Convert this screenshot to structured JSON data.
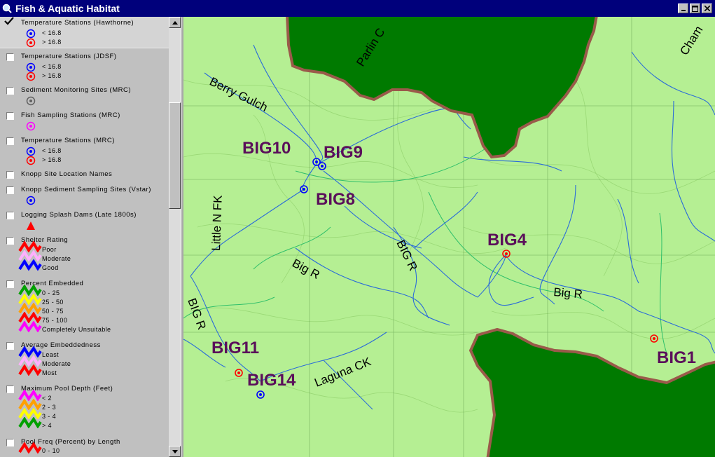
{
  "window": {
    "title": "Fish & Aquatic Habitat"
  },
  "toc": {
    "layers": [
      {
        "name": "Temperature Stations (Hawthorne)",
        "checked": true,
        "legend": [
          {
            "label": "< 16.8",
            "symbol": "blue-station-icon"
          },
          {
            "label": "> 16.8",
            "symbol": "red-station-icon"
          }
        ]
      },
      {
        "name": "Temperature Stations (JDSF)",
        "checked": false,
        "legend": [
          {
            "label": "< 16.8",
            "symbol": "blue-station-icon"
          },
          {
            "label": "> 16.8",
            "symbol": "red-station-icon"
          }
        ]
      },
      {
        "name": "Sediment Monitoring Sites (MRC)",
        "checked": false,
        "legend": [
          {
            "label": "",
            "symbol": "gray-station-icon"
          }
        ]
      },
      {
        "name": "Fish Sampling Stations (MRC)",
        "checked": false,
        "legend": [
          {
            "label": "",
            "symbol": "magenta-station-icon"
          }
        ]
      },
      {
        "name": "Temperature Stations (MRC)",
        "checked": false,
        "legend": [
          {
            "label": "< 16.8",
            "symbol": "blue-station-icon"
          },
          {
            "label": "> 16.8",
            "symbol": "red-station-icon"
          }
        ]
      },
      {
        "name": "Knopp Site Location Names",
        "checked": false,
        "legend": []
      },
      {
        "name": "Knopp Sediment Sampling Sites (Vstar)",
        "checked": false,
        "legend": [
          {
            "label": "",
            "symbol": "blue-station-icon"
          }
        ]
      },
      {
        "name": "Logging Splash Dams (Late 1800s)",
        "checked": false,
        "legend": [
          {
            "label": "",
            "symbol": "red-triangle-icon"
          }
        ]
      },
      {
        "name": "Shelter Rating",
        "checked": false,
        "legend": [
          {
            "label": "Poor",
            "color": "#ff0000"
          },
          {
            "label": "Moderate",
            "color": "#ffb0ff"
          },
          {
            "label": "Good",
            "color": "#0000ff"
          }
        ]
      },
      {
        "name": "Percent Embedded",
        "checked": false,
        "legend": [
          {
            "label": "0 - 25",
            "color": "#00a000"
          },
          {
            "label": "25 - 50",
            "color": "#ffff00"
          },
          {
            "label": "50 - 75",
            "color": "#ffa000"
          },
          {
            "label": "75 - 100",
            "color": "#ff0000"
          },
          {
            "label": "Completely Unsuitable",
            "color": "#ff00ff"
          }
        ]
      },
      {
        "name": "Average Embeddedness",
        "checked": false,
        "legend": [
          {
            "label": "Least",
            "color": "#0000ff"
          },
          {
            "label": "Moderate",
            "color": "#ffb0ff"
          },
          {
            "label": "Most",
            "color": "#ff0000"
          }
        ]
      },
      {
        "name": "Maximum Pool Depth (Feet)",
        "checked": false,
        "legend": [
          {
            "label": "< 2",
            "color": "#ff00ff"
          },
          {
            "label": "2 - 3",
            "color": "#ffa000"
          },
          {
            "label": "3 - 4",
            "color": "#ffff00"
          },
          {
            "label": "> 4",
            "color": "#00a000"
          }
        ]
      },
      {
        "name": "Pool Freq (Percent) by Length",
        "checked": false,
        "legend": [
          {
            "label": "0 - 10",
            "color": "#ff0000"
          }
        ]
      }
    ]
  },
  "map": {
    "colors": {
      "terrain": "#b5ef93",
      "forest_mask": "#007a00",
      "mask_border": "#9a5a4a",
      "streams": "#2b6cd8",
      "site_label": "#5a0f5a"
    },
    "site_labels": [
      "BIG10",
      "BIG9",
      "BIG8",
      "BIG4",
      "BIG1",
      "BIG11",
      "BIG14"
    ],
    "feature_labels": [
      "Parlin C",
      "Cham",
      "Berry Gulch",
      "Little N FK",
      "Big R",
      "BIG R",
      "Big R",
      "BIG R",
      "Laguna CK"
    ]
  }
}
